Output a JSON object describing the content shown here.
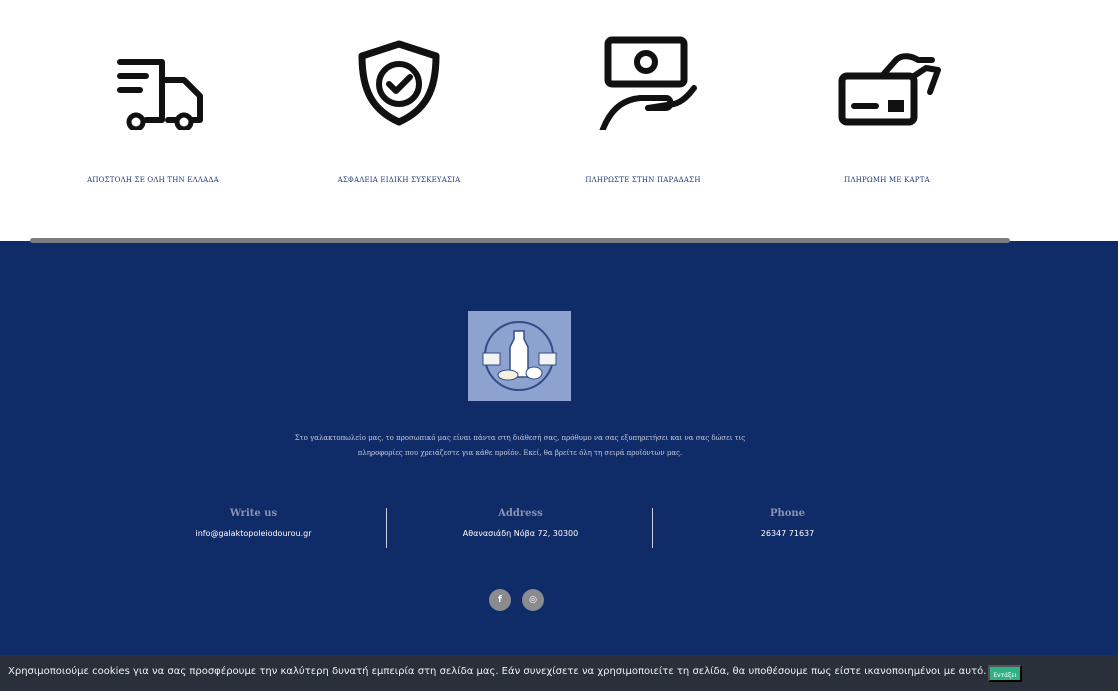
{
  "features": [
    {
      "icon": "delivery-truck-icon",
      "label": "ΑΠΟΣΤΟΛΗ ΣΕ ΟΛΗ ΤΗΝ ΕΛΛΑΔΑ"
    },
    {
      "icon": "shield-check-icon",
      "label": "ΑΣΦΑΛΕΙΑ ΕΙΔΙΚΗ ΣΥΣΚΕΥΑΣΙΑ"
    },
    {
      "icon": "cash-in-hand-icon",
      "label": "ΠΛΗΡΩΣΤΕ ΣΤΗΝ ΠΑΡΑΔΑΣΗ"
    },
    {
      "icon": "card-payment-icon",
      "label": "ΠΛΗΡΩΜΗ ΜΕ ΚΑΡΤΑ"
    }
  ],
  "footer": {
    "logo_icon": "dairy-shop-logo",
    "about_text": "Στο γαλακτοπωλείο μας, το προσωπικό μας είναι πάντα στη διάθεσή σας, πρόθυμο να σας εξυπηρετήσει και να σας δώσει τις πληροφορίες που χρειάζεστε για κάθε προϊόν. Εκεί, θα βρείτε όλη τη σειρά προϊόντων μας.",
    "contacts": [
      {
        "heading": "Write us",
        "value": "info@galaktopoleiodourou.gr"
      },
      {
        "heading": "Address",
        "value": "Αθανασιάδη Νόβα 72, 30300"
      },
      {
        "heading": "Phone",
        "value": "26347 71637"
      }
    ],
    "social": [
      {
        "icon": "facebook-icon",
        "glyph": "f"
      },
      {
        "icon": "instagram-icon",
        "glyph": "◎"
      }
    ],
    "colors": {
      "background": "#0f2b68",
      "divider": "#7b7d80"
    }
  },
  "cookie_bar": {
    "message": "Χρησιμοποιούμε cookies για να σας προσφέρουμε την καλύτερη δυνατή εμπειρία στη σελίδα μας. Εάν συνεχίσετε να χρησιμοποιείτε τη σελίδα, θα υποθέσουμε πως είστε ικανοποιημένοι με αυτό.",
    "button_label": "Εντάξει",
    "button_color": "#2db286"
  }
}
